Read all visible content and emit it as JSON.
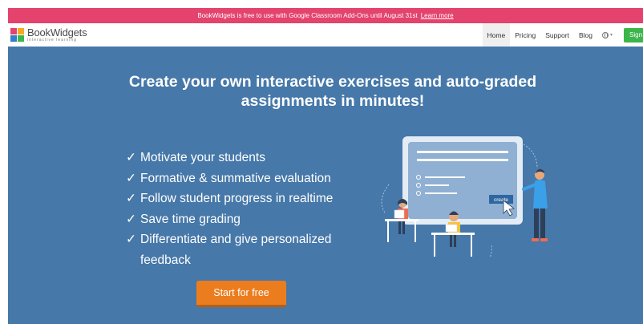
{
  "banner": {
    "text": "BookWidgets is free to use with Google Classroom Add-Ons until August 31st",
    "link_label": "Learn more"
  },
  "brand": {
    "name": "BookWidgets",
    "tagline": "interactive learning",
    "logo_colors": [
      "#e3436d",
      "#f7a823",
      "#3cb54a",
      "#2f80c8"
    ]
  },
  "nav": {
    "home": "Home",
    "pricing": "Pricing",
    "support": "Support",
    "blog": "Blog",
    "language_icon": "globe-icon",
    "signup": "Sign"
  },
  "hero": {
    "title_line1": "Create your own interactive exercises and auto-graded",
    "title_line2": "assignments in minutes!",
    "features": [
      "Motivate your students",
      "Formative & summative evaluation",
      "Follow student progress in realtime",
      "Save time grading",
      "Differentiate and give personalized",
      "feedback"
    ],
    "cta": "Start for free",
    "illustration_button": "create",
    "check_glyph": "✓"
  },
  "colors": {
    "banner": "#e3436d",
    "hero_bg": "#4678a9",
    "cta": "#ec7d1e",
    "signup": "#3cb54a"
  }
}
